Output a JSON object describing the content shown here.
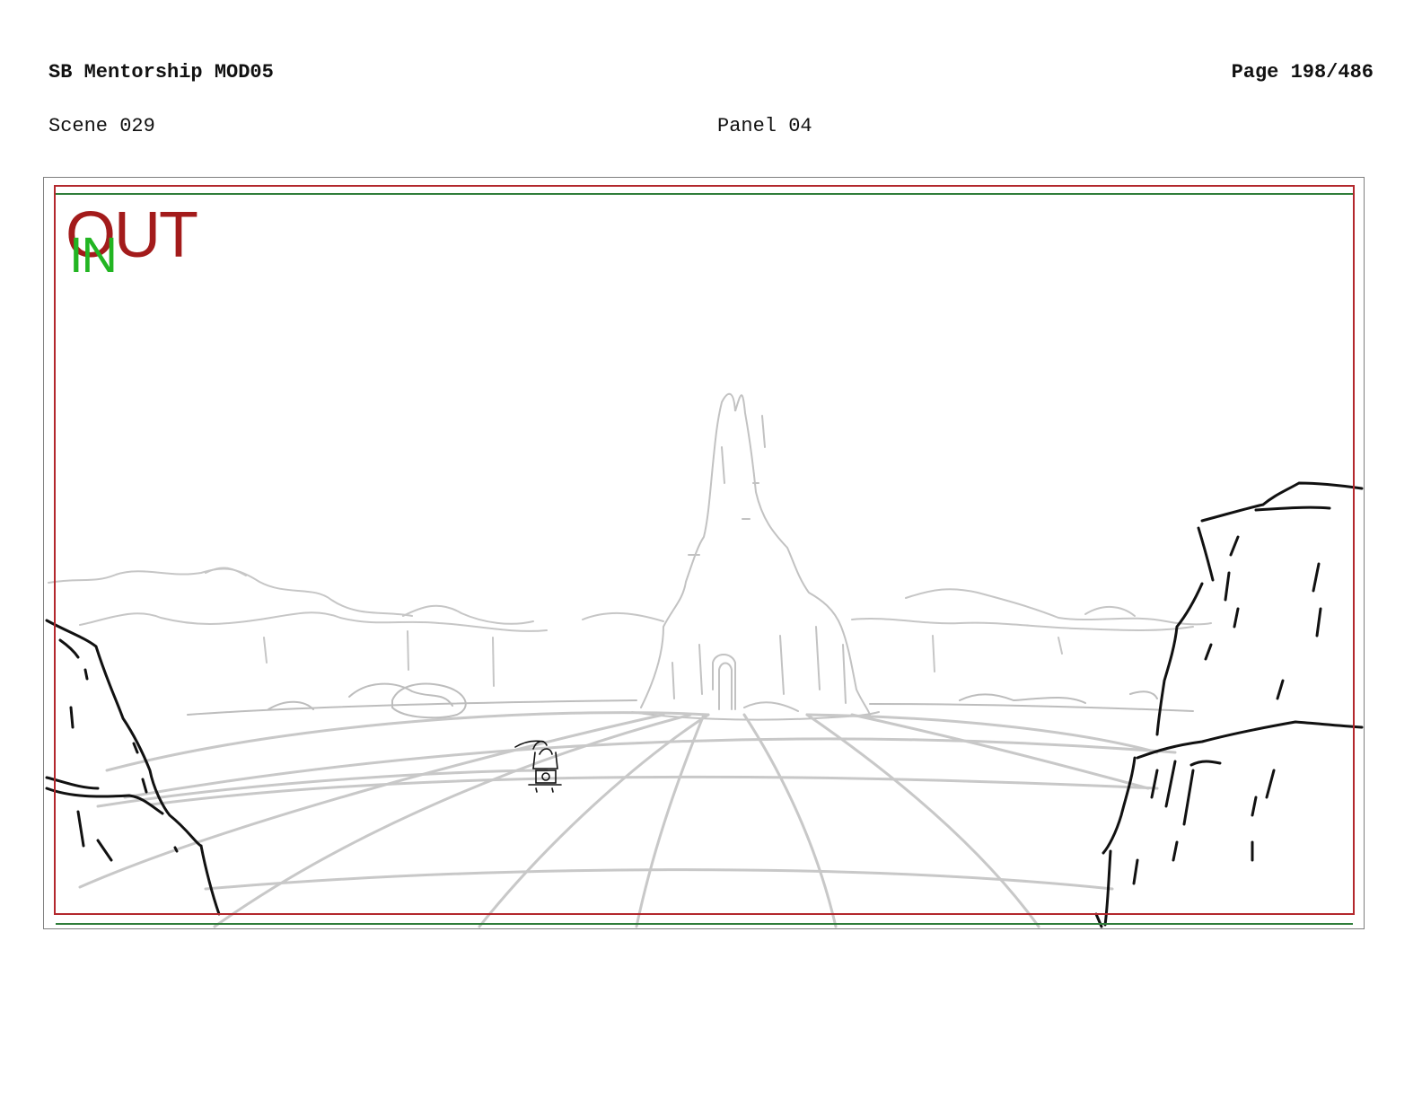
{
  "header": {
    "project_title": "SB Mentorship MOD05",
    "page_label": "Page 198/486",
    "scene_label": "Scene 029",
    "panel_label": "Panel 04"
  },
  "panel": {
    "marks": {
      "out": "OUT",
      "in": "IN"
    },
    "colors": {
      "out_mark": "#a31b1b",
      "in_mark": "#22b522",
      "safe_red": "#b3282d",
      "safe_green": "#2f7d3a",
      "sketch_dark": "#111111",
      "sketch_light": "#bdbdbd"
    }
  }
}
